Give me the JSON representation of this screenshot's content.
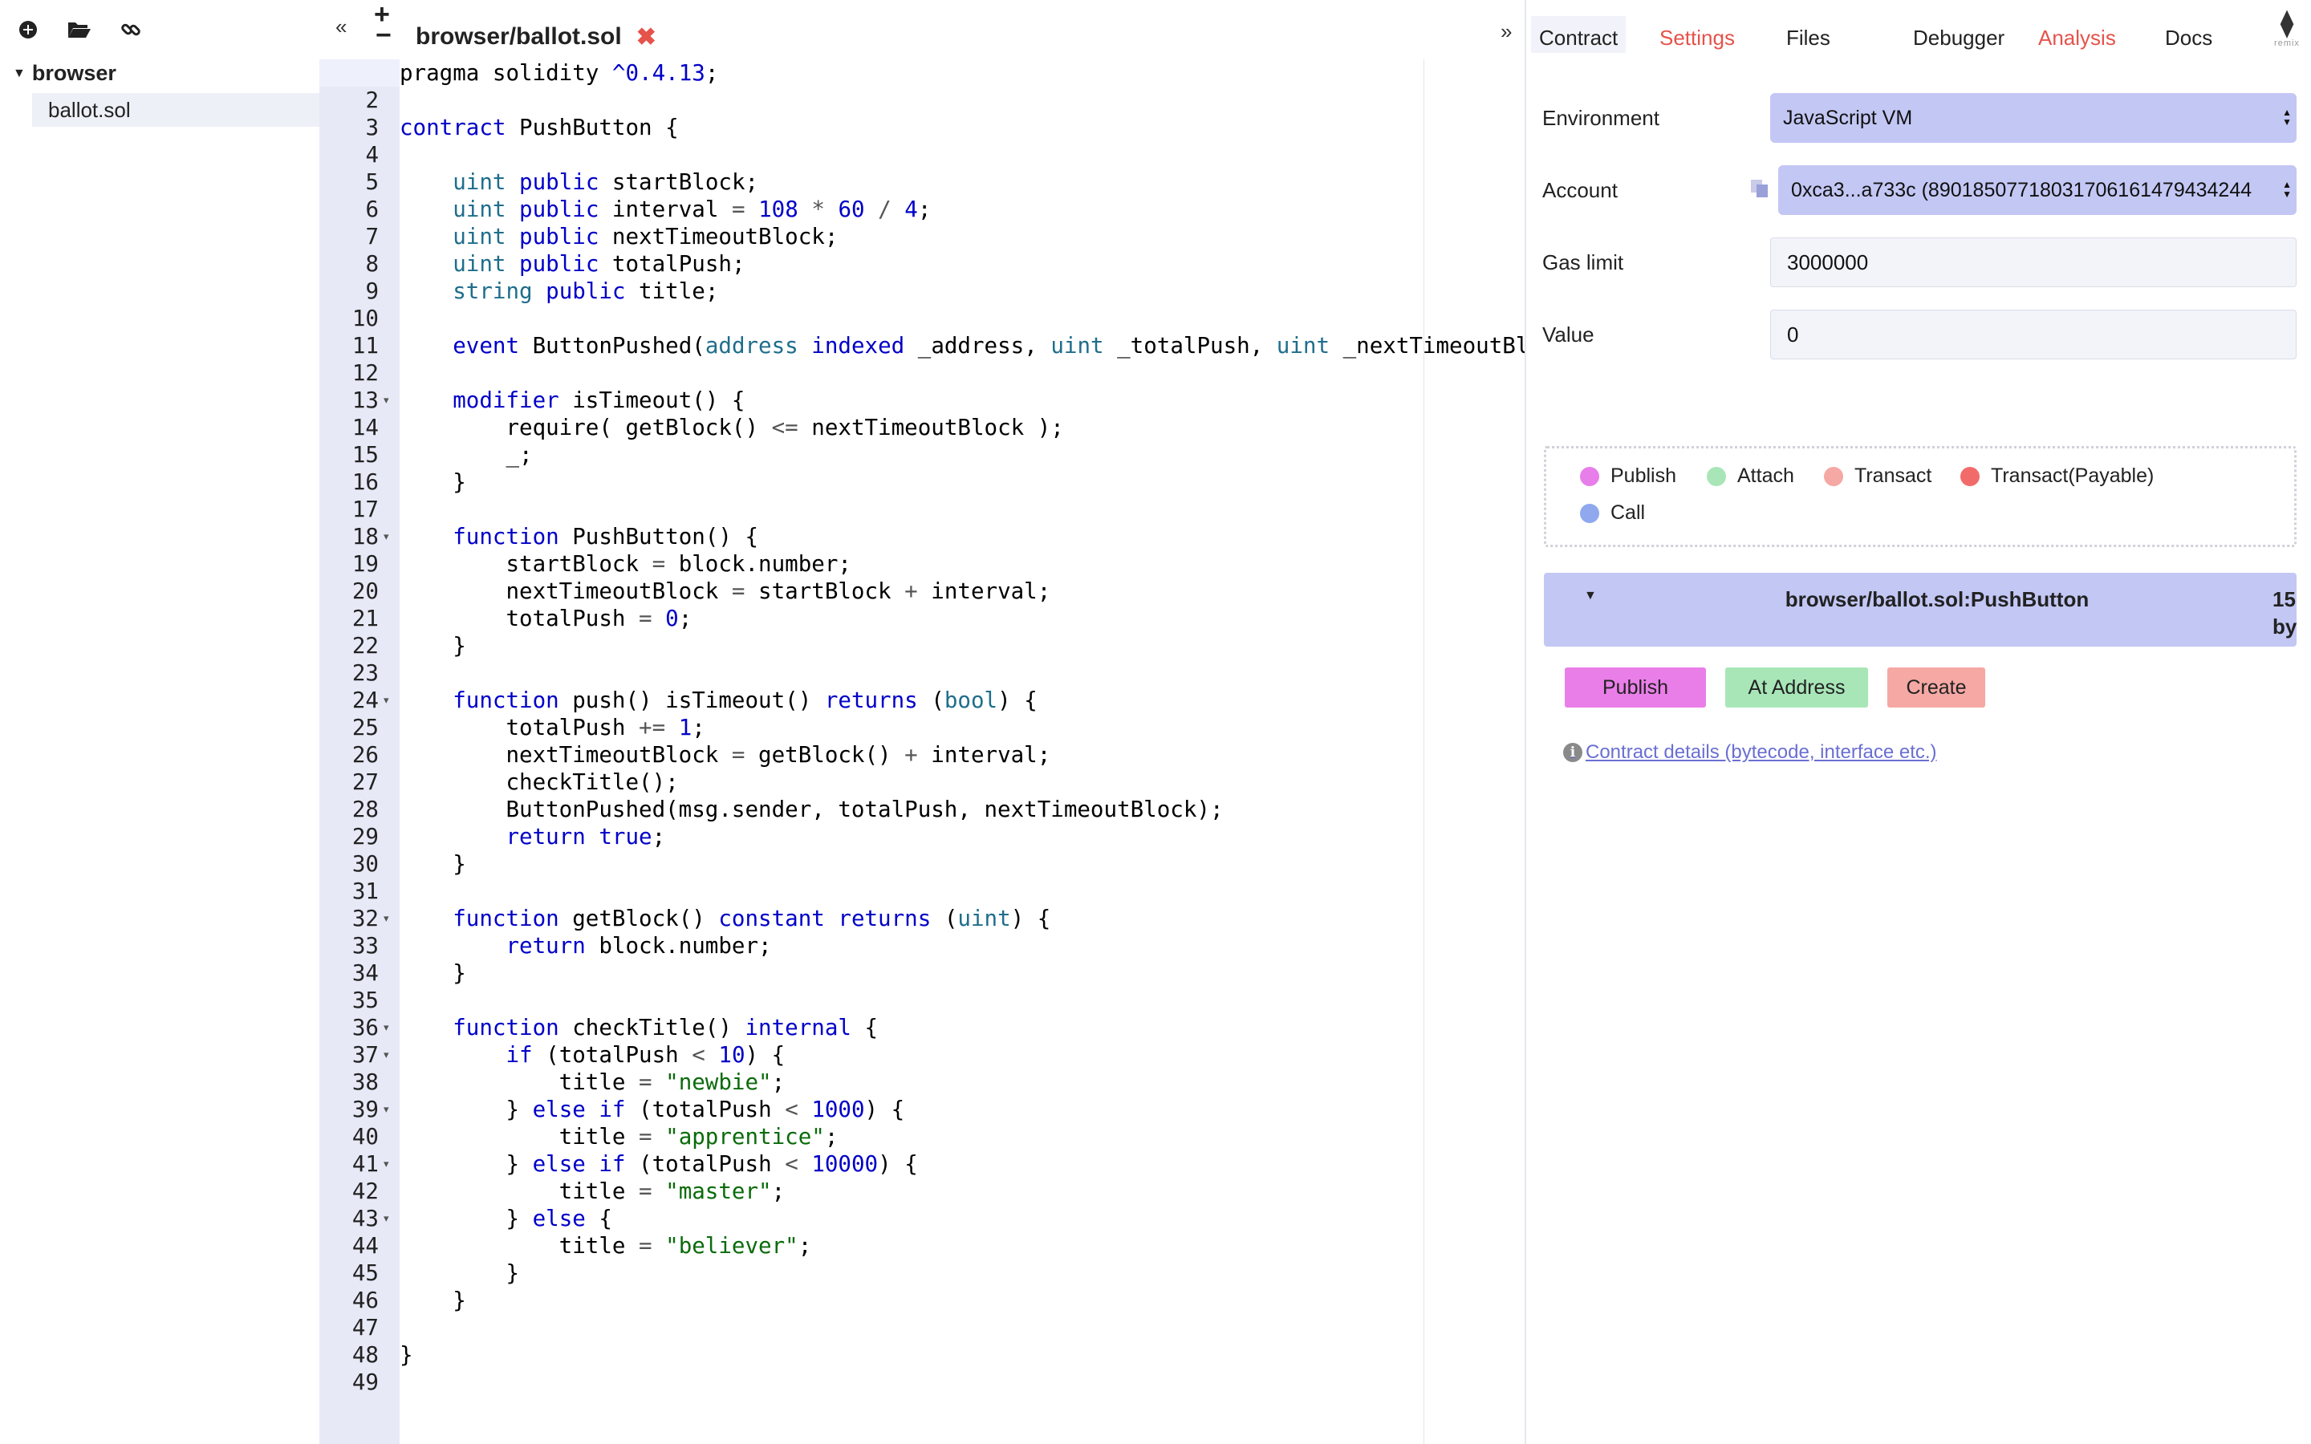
{
  "explorer": {
    "root_folder": "browser",
    "files": [
      "ballot.sol"
    ],
    "toolbar_icons": [
      "add-file-icon",
      "open-folder-icon",
      "link-icon"
    ]
  },
  "editor": {
    "active_tab": "browser/ballot.sol",
    "close_glyph": "✖",
    "collapse_glyph": "«",
    "expand_glyph": "»",
    "add_glyph": "+",
    "remove_glyph": "−",
    "fold_lines": [
      13,
      18,
      24,
      32,
      36,
      37,
      39,
      41,
      43
    ],
    "lines": [
      "pragma solidity ^0.4.13;",
      "",
      "contract PushButton {",
      "",
      "    uint public startBlock;",
      "    uint public interval = 108 * 60 / 4;",
      "    uint public nextTimeoutBlock;",
      "    uint public totalPush;",
      "    string public title;",
      "",
      "    event ButtonPushed(address indexed _address, uint _totalPush, uint _nextTimeoutBlock",
      "",
      "    modifier isTimeout() {",
      "        require( getBlock() <= nextTimeoutBlock );",
      "        _;",
      "    }",
      "",
      "    function PushButton() {",
      "        startBlock = block.number;",
      "        nextTimeoutBlock = startBlock + interval;",
      "        totalPush = 0;",
      "    }",
      "",
      "    function push() isTimeout() returns (bool) {",
      "        totalPush += 1;",
      "        nextTimeoutBlock = getBlock() + interval;",
      "        checkTitle();",
      "        ButtonPushed(msg.sender, totalPush, nextTimeoutBlock);",
      "        return true;",
      "    }",
      "",
      "    function getBlock() constant returns (uint) {",
      "        return block.number;",
      "    }",
      "",
      "    function checkTitle() internal {",
      "        if (totalPush < 10) {",
      "            title = \"newbie\";",
      "        } else if (totalPush < 1000) {",
      "            title = \"apprentice\";",
      "        } else if (totalPush < 10000) {",
      "            title = \"master\";",
      "        } else {",
      "            title = \"believer\";",
      "        }",
      "    }",
      "",
      "}",
      ""
    ]
  },
  "right_tabs": [
    {
      "label": "Contract",
      "color": "#222222",
      "active": true
    },
    {
      "label": "Settings",
      "color": "#e5534b",
      "active": false
    },
    {
      "label": "Files",
      "color": "#222222",
      "active": false
    },
    {
      "label": "Debugger",
      "color": "#222222",
      "active": false
    },
    {
      "label": "Analysis",
      "color": "#e5534b",
      "active": false
    },
    {
      "label": "Docs",
      "color": "#222222",
      "active": false
    }
  ],
  "remix_logo": {
    "glyph": "⧫",
    "text": "remix"
  },
  "run": {
    "environment_label": "Environment",
    "environment_value": "JavaScript VM",
    "account_label": "Account",
    "account_value": "0xca3...a733c (89018507718031706161479434244",
    "gas_limit_label": "Gas limit",
    "gas_limit_value": "3000000",
    "value_label": "Value",
    "value_value": "0"
  },
  "legend": [
    {
      "label": "Publish",
      "color": "#e77ee9"
    },
    {
      "label": "Attach",
      "color": "#a8e6b8"
    },
    {
      "label": "Transact",
      "color": "#f5a8a4"
    },
    {
      "label": "Transact(Payable)",
      "color": "#f26b6b"
    },
    {
      "label": "Call",
      "color": "#8fa8ee"
    }
  ],
  "contract": {
    "name": "browser/ballot.sol:PushButton",
    "gas_line1": "15",
    "gas_line2": "by"
  },
  "actions": [
    {
      "label": "Publish",
      "color": "#ea7ee9"
    },
    {
      "label": "At Address",
      "color": "#a8e6b8"
    },
    {
      "label": "Create",
      "color": "#f5a8a4"
    }
  ],
  "details_link": "Contract details (bytecode, interface etc.)",
  "info_glyph": "i"
}
